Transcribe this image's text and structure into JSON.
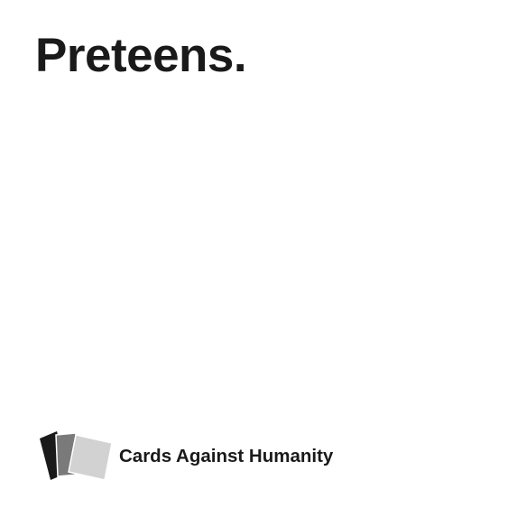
{
  "card": {
    "text": "Preteens."
  },
  "brand": {
    "name": "Cards Against Humanity",
    "logo_icon": "stacked-cards-logo-icon",
    "logo_colors": [
      "#1a1a1a",
      "#7a7a7a",
      "#d2d2d2"
    ]
  }
}
